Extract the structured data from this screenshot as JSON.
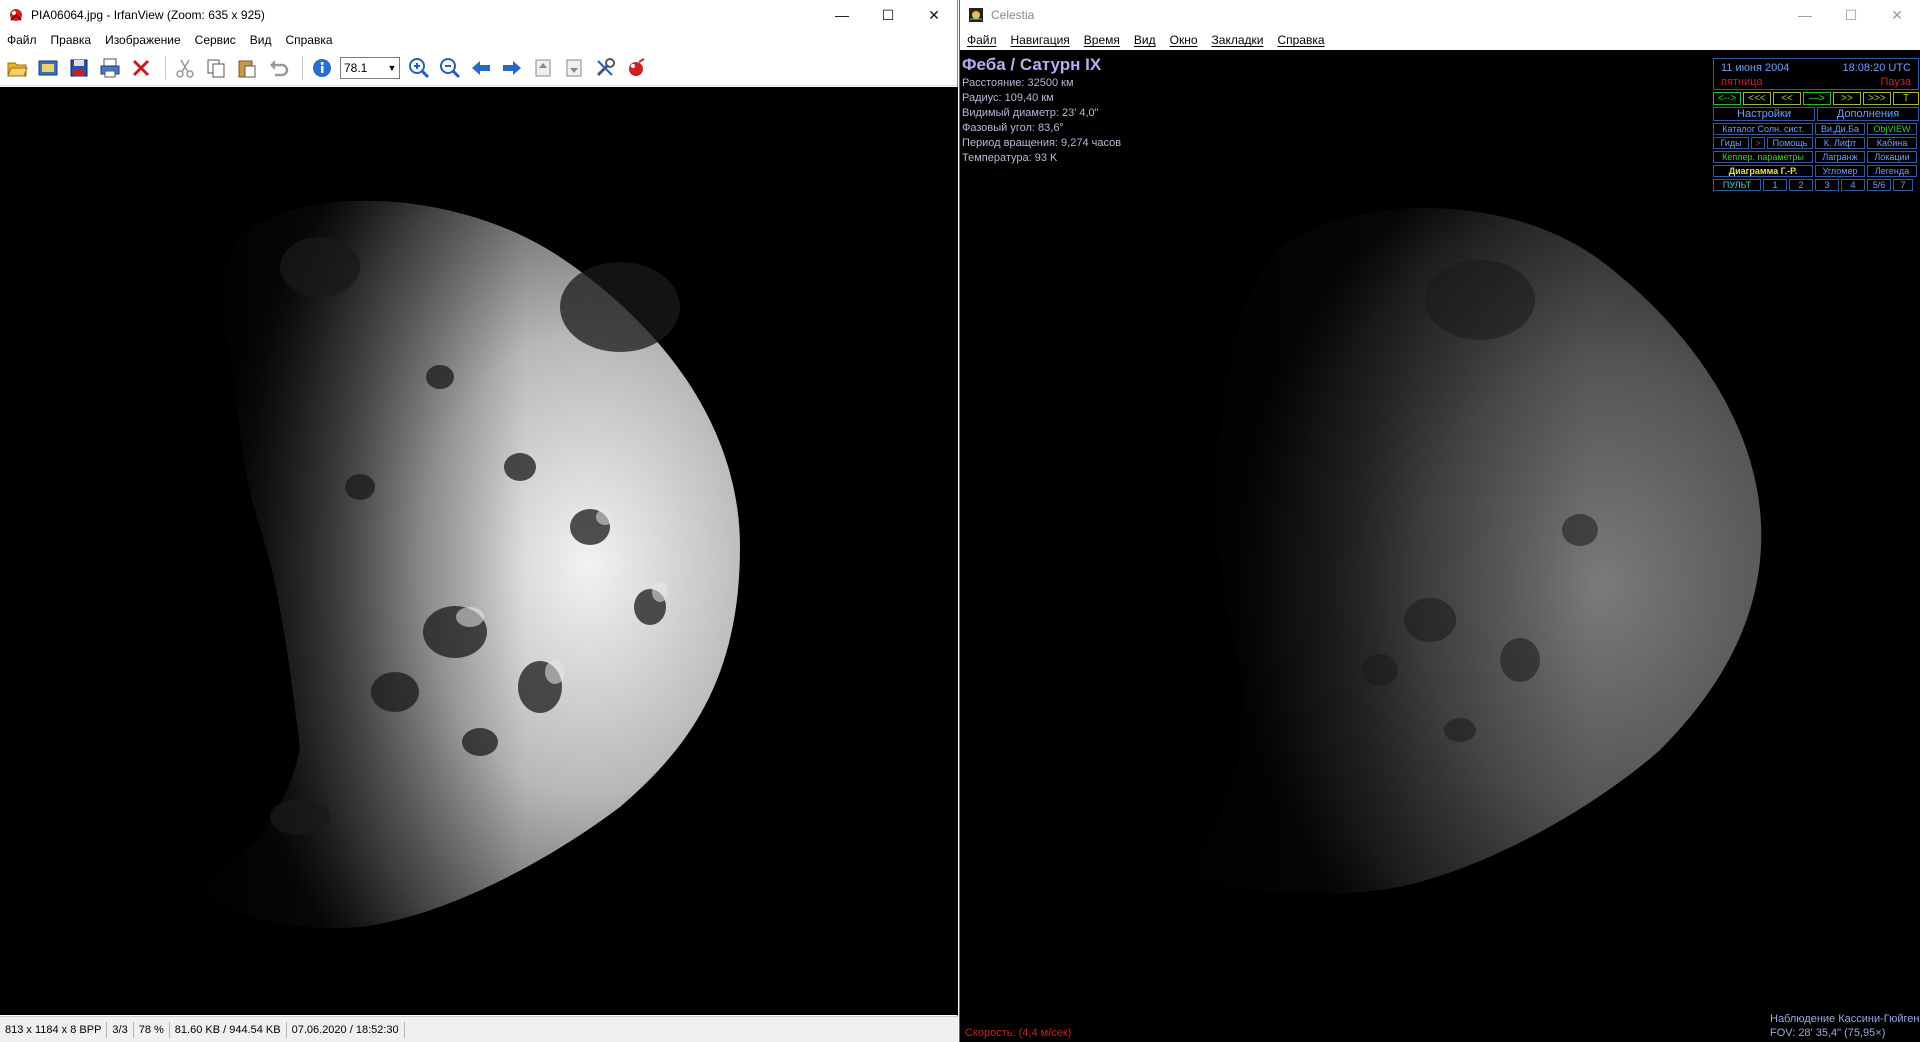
{
  "irfanview": {
    "title": "PIA06064.jpg - IrfanView (Zoom: 635 x 925)",
    "window_controls": {
      "minimize": "—",
      "maximize": "☐",
      "close": "✕"
    },
    "menu": [
      "Файл",
      "Правка",
      "Изображение",
      "Сервис",
      "Вид",
      "Справка"
    ],
    "toolbar": {
      "icons": [
        "open-folder-icon",
        "slideshow-icon",
        "save-icon",
        "print-icon",
        "delete-icon",
        "cut-icon",
        "copy-icon",
        "paste-icon",
        "undo-icon",
        "info-icon",
        "zoom-in-icon",
        "zoom-out-icon",
        "previous-icon",
        "next-icon",
        "first-page-icon",
        "last-page-icon",
        "settings-icon",
        "irfan-logo-icon"
      ],
      "zoom_value": "78.1"
    },
    "status": {
      "dimensions": "813 x 1184 x 8 BPP",
      "index": "3/3",
      "zoom": "78 %",
      "filesize": "81.60 KB / 944.54 KB",
      "datetime": "07.06.2020 / 18:52:30"
    }
  },
  "celestia": {
    "title": "Celestia",
    "window_controls": {
      "minimize": "—",
      "maximize": "☐",
      "close": "✕"
    },
    "menu": [
      "Файл",
      "Навигация",
      "Время",
      "Вид",
      "Окно",
      "Закладки",
      "Справка"
    ],
    "info": {
      "name": "Феба / Сатурн IX",
      "lines": [
        "Расстояние: 32500 км",
        "Радиус: 109,40 км",
        "Видимый диаметр: 23' 4,0\"",
        "Фазовый угол: 83,6°",
        "Период вращения: 9,274 часов",
        "Температура: 93 K"
      ]
    },
    "hud": {
      "date": "11 июня 2004",
      "time": "18:08:20  UTC",
      "weekday": "пятница",
      "status": "Пауза",
      "time_buttons": [
        "<-->",
        "<<<",
        "<<",
        "—>",
        ">>",
        ">>>",
        "T"
      ],
      "row_settings": [
        "Настройки",
        "Дополнения"
      ],
      "row_catalog": [
        "Каталог Солн. сист.",
        "Ви,Ди,Ба",
        "ObjVIEW"
      ],
      "row_guides": [
        "Гиды",
        ">",
        "Помощь",
        "К. Лифт",
        "Кабина"
      ],
      "row_kepler": [
        "Кеплер. параметры",
        "Лагранж",
        "Локации"
      ],
      "row_diagram": [
        "Диаграмма Г.-Р.",
        "Угломер",
        "Легенда"
      ],
      "row_console": [
        "ПУЛЬТ",
        "1",
        "2",
        "3",
        "4",
        "5/6",
        "7"
      ]
    },
    "speed": "Скорость: (4,4 м/сек)",
    "observation": "Наблюдение Кассини-Гюйгенс",
    "fov": "FOV: 28' 35,4\" (75,95×)"
  }
}
